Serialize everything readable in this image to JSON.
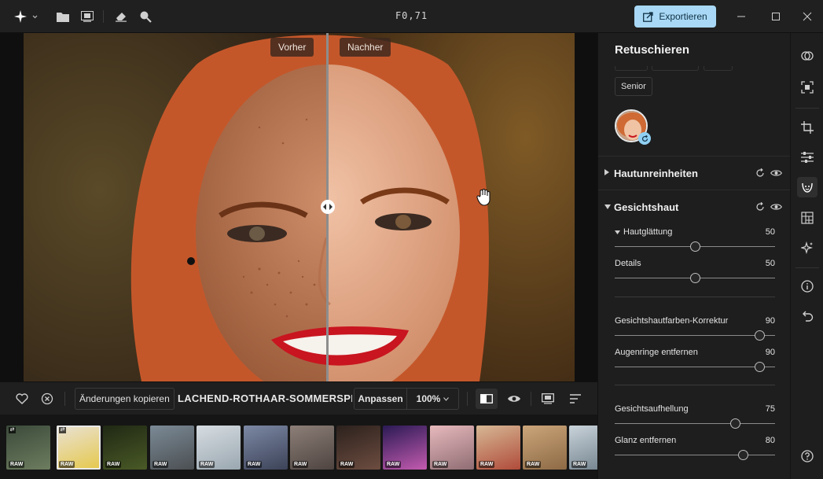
{
  "app": {
    "title": "F0,71",
    "export_label": "Exportieren"
  },
  "viewer": {
    "before_label": "Vorher",
    "after_label": "Nachher"
  },
  "bottombar": {
    "copy_label": "Änderungen kopieren",
    "file_name": "LACHEND-ROTHAAR-SOMMERSPROS...",
    "fit_label": "Anpassen",
    "zoom_label": "100%"
  },
  "filmstrip": {
    "badge": "RAW",
    "thumbs": [
      {
        "colors": [
          "#3b4a3a",
          "#6d7d5f"
        ]
      },
      {
        "colors": [
          "#e9e2d6",
          "#e5c84a"
        ]
      },
      {
        "colors": [
          "#1f2814",
          "#4a5a26"
        ]
      },
      {
        "colors": [
          "#7b8a96",
          "#4b4f52"
        ]
      },
      {
        "colors": [
          "#d7dde2",
          "#9aa7b0"
        ]
      },
      {
        "colors": [
          "#7c88a4",
          "#3c4358"
        ]
      },
      {
        "colors": [
          "#8d7f78",
          "#4e4440"
        ]
      },
      {
        "colors": [
          "#2c211d",
          "#6d4d40"
        ]
      },
      {
        "colors": [
          "#2a1a54",
          "#c45bb0"
        ]
      },
      {
        "colors": [
          "#e7b9bd",
          "#8f6d73"
        ]
      },
      {
        "colors": [
          "#d6b895",
          "#b04b3a"
        ]
      },
      {
        "colors": [
          "#cba57a",
          "#8d6a45"
        ]
      },
      {
        "colors": [
          "#c9d3da",
          "#6f7f8a"
        ]
      }
    ]
  },
  "panel": {
    "title": "Retuschieren",
    "age_chip": "Senior",
    "sections": {
      "blemishes": "Hautunreinheiten",
      "face_skin": "Gesichtshaut"
    },
    "sliders": [
      {
        "label": "Hautglättung",
        "value": "50",
        "level": 0.5
      },
      {
        "label": "Details",
        "value": "50",
        "level": 0.5
      },
      {
        "label": "Gesichtshautfarben-Korrektur",
        "value": "90",
        "level": 0.9
      },
      {
        "label": "Augenringe entfernen",
        "value": "90",
        "level": 0.9
      },
      {
        "label": "Gesichtsaufhellung",
        "value": "75",
        "level": 0.75
      },
      {
        "label": "Glanz entfernen",
        "value": "80",
        "level": 0.8
      }
    ]
  },
  "colors": {
    "accent": "#a8d8f5",
    "panel_bg": "#1e1e1e",
    "hair": "#d9632c",
    "lips": "#c8151f"
  }
}
